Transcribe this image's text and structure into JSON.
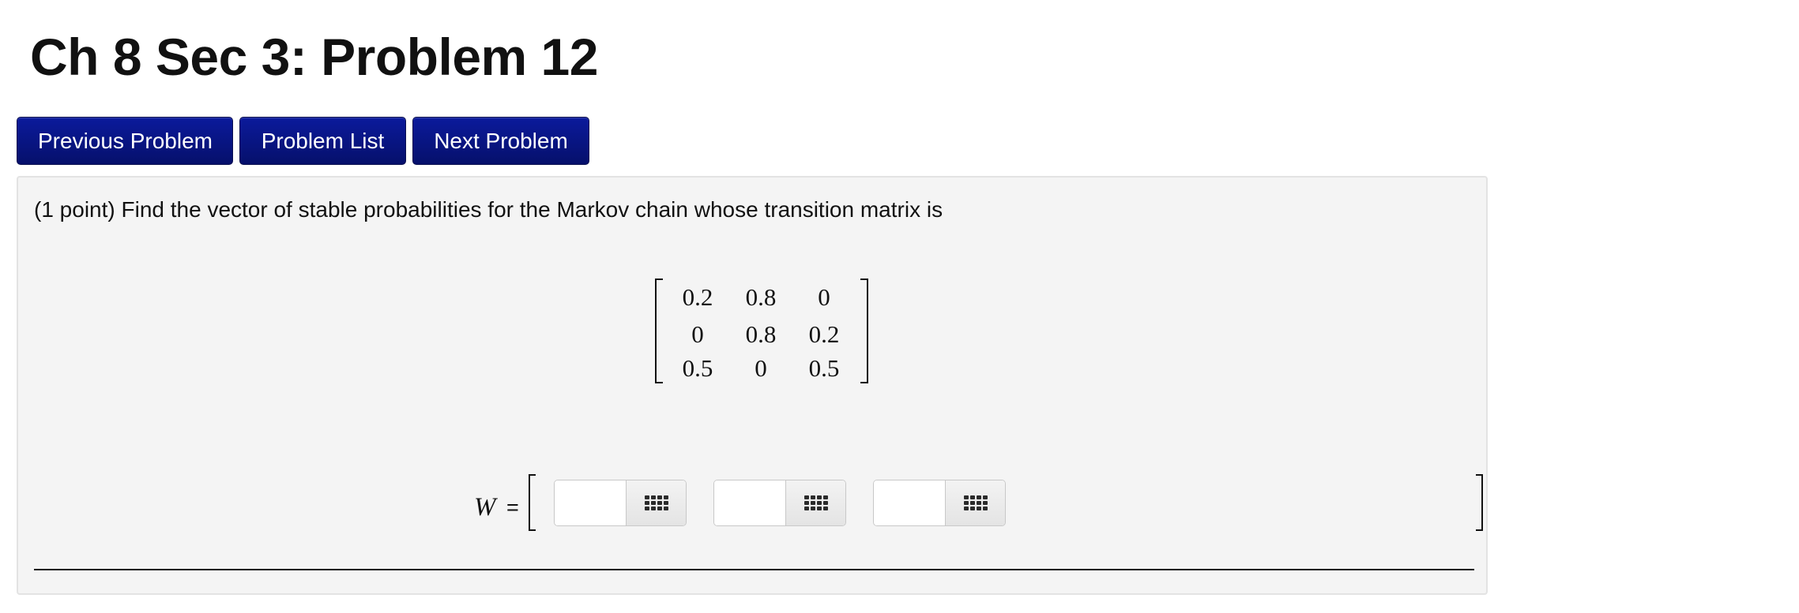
{
  "page": {
    "title": "Ch 8 Sec 3: Problem 12"
  },
  "nav": {
    "previous_label": "Previous Problem",
    "list_label": "Problem List",
    "next_label": "Next Problem"
  },
  "problem": {
    "text": "(1 point) Find the vector of stable probabilities for the Markov chain whose transition matrix is",
    "matrix": [
      [
        "0.2",
        "0.8",
        "0"
      ],
      [
        "0",
        "0.8",
        "0.2"
      ],
      [
        "0.5",
        "0",
        "0.5"
      ]
    ]
  },
  "answer": {
    "variable_label": "W",
    "equals": "=",
    "fields": [
      {
        "value": "",
        "palette_icon": "grid-icon"
      },
      {
        "value": "",
        "palette_icon": "grid-icon"
      },
      {
        "value": "",
        "palette_icon": "grid-icon"
      }
    ]
  },
  "colors": {
    "button_bg": "#08138a",
    "panel_bg": "#f4f4f4"
  }
}
